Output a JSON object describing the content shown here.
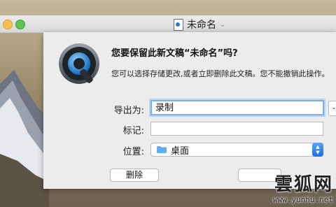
{
  "window": {
    "title": "未命名"
  },
  "dialog": {
    "heading": "您要保留此新文稿“未命名”吗?",
    "message": "您可以选择存储更改,或者立即删除此文稿。您不能撤销此操作。",
    "export_as_label": "导出为:",
    "export_as_value": "录制",
    "tags_label": "标记:",
    "tags_value": "",
    "location_label": "位置:",
    "location_value": "桌面",
    "delete_button_label": "删除"
  },
  "watermark": {
    "brand": "雲狐网",
    "url": "www.yunhu.net"
  },
  "icons": {
    "app": "quicktime-icon",
    "document": "document-icon",
    "folder": "folder-icon"
  },
  "colors": {
    "accent": "#1b6ee6",
    "focus_ring": "#7eaee8",
    "sheet_bg": "#ececec"
  }
}
